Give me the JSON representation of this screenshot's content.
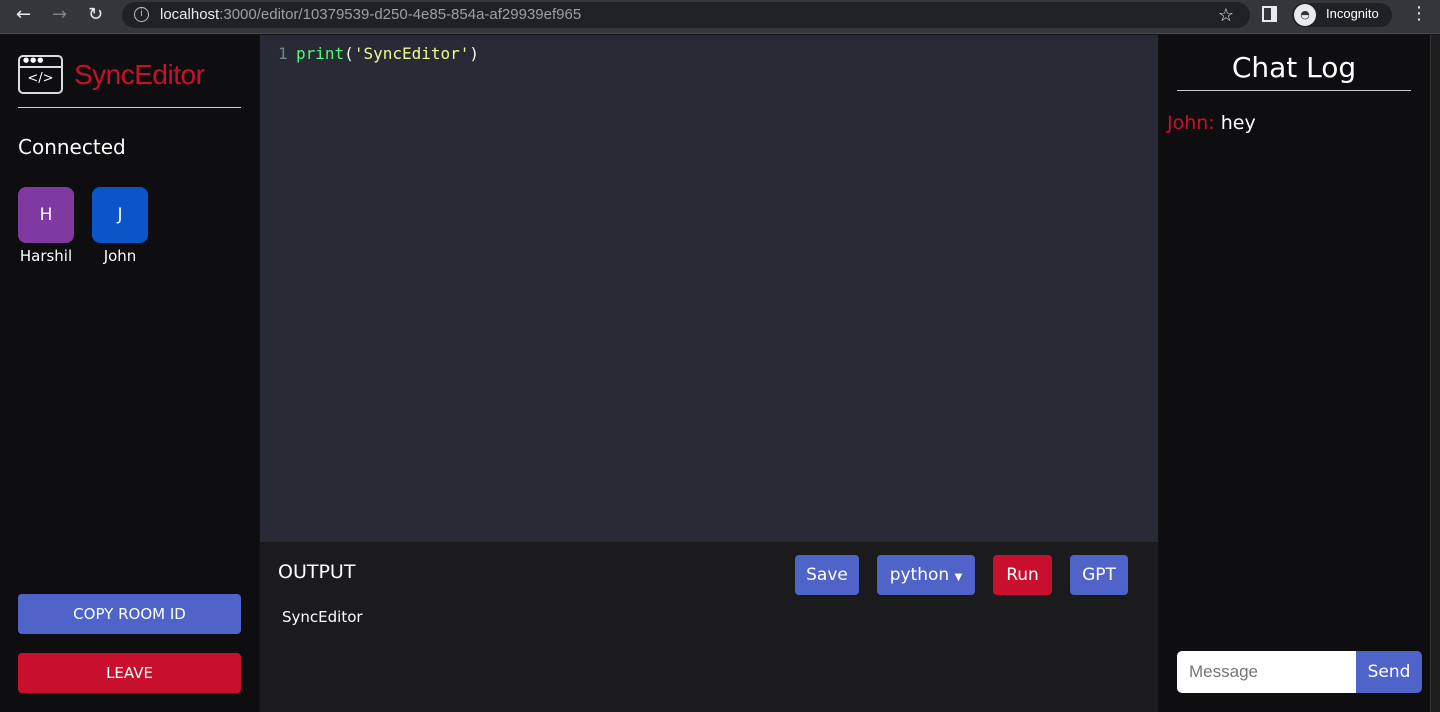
{
  "browser": {
    "url_host": "localhost",
    "url_rest": ":3000/editor/10379539-d250-4e85-854a-af29939ef965",
    "profile": "Incognito"
  },
  "sidebar": {
    "brand": "SyncEditor",
    "connected_label": "Connected",
    "users": [
      {
        "initial": "H",
        "name": "Harshil",
        "color": "#7e3aa0"
      },
      {
        "initial": "J",
        "name": "John",
        "color": "#0a55c8"
      }
    ],
    "copy_room_id": "COPY ROOM ID",
    "leave": "LEAVE"
  },
  "editor": {
    "line_number": "1",
    "code_fn": "print",
    "code_open": "(",
    "code_str": "'SyncEditor'",
    "code_close": ")"
  },
  "output": {
    "label": "OUTPUT",
    "text": "SyncEditor",
    "save": "Save",
    "language": "python",
    "run": "Run",
    "gpt": "GPT"
  },
  "chat": {
    "title": "Chat Log",
    "messages": [
      {
        "author": "John:",
        "text": "hey"
      }
    ],
    "placeholder": "Message",
    "send": "Send"
  },
  "colors": {
    "accent": "#c8102e",
    "button": "#4f63c9"
  }
}
